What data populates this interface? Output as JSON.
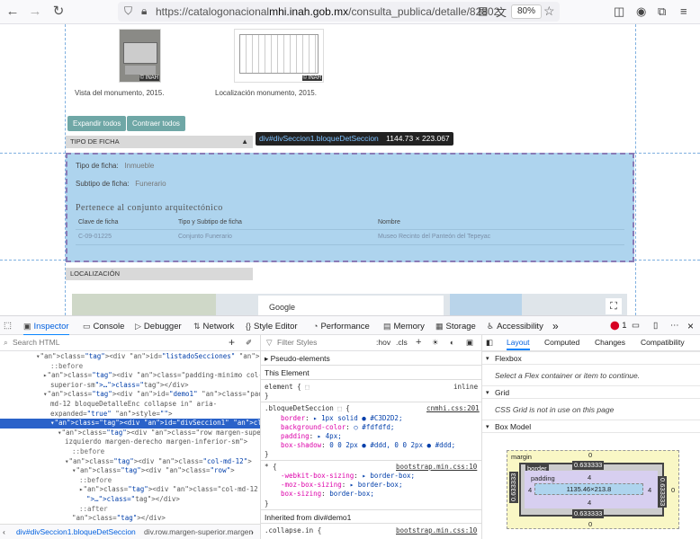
{
  "browser": {
    "url_prefix": "https://catalogonacional",
    "url_domain": "mhi.inah.gob.mx",
    "url_path": "/consulta_publica/detalle/82802",
    "zoom": "80%"
  },
  "page": {
    "thumb1_watermark": "© INAH",
    "thumb2_watermark": "© INAH",
    "caption1": "Vista del monumento, 2015.",
    "caption2": "Localización monumento, 2015.",
    "expand_all": "Expandir todos",
    "collapse_all": "Contraer todos",
    "section1_title": "TIPO DE FICHA",
    "section2_title": "LOCALIZACIÓN",
    "tooltip_selector": "div#divSeccion1.bloqueDetSeccion",
    "tooltip_size": "1144.73 × 223.067",
    "tipo_label": "Tipo de ficha:",
    "tipo_value": "Inmueble",
    "subtipo_label": "Subtipo de ficha:",
    "subtipo_value": "Funerario",
    "conjunto_heading": "Pertenece al conjunto arquitectónico",
    "table_headers": [
      "Clave de ficha",
      "Tipo y Subtipo de ficha",
      "Nombre"
    ],
    "table_row": [
      "C-09-01225",
      "Conjunto Funerario",
      "Museo Recinto del Panteón del Tepeyac"
    ],
    "map_popup": "Google"
  },
  "devtools": {
    "tabs": [
      "Inspector",
      "Console",
      "Debugger",
      "Network",
      "Style Editor",
      "Performance",
      "Memory",
      "Storage",
      "Accessibility"
    ],
    "error_count": "1",
    "search_html": "Search HTML",
    "filter_styles": "Filter Styles",
    "hov": ":hov",
    "cls": ".cls",
    "html_lines": [
      {
        "indent": 40,
        "text": "▾<div id=\"listadoSecciones\" class=\"row\">"
      },
      {
        "indent": 56,
        "text": "::before"
      },
      {
        "indent": 48,
        "text": "▸<div class=\"padding-minimo col-md-4 margen-"
      },
      {
        "indent": 56,
        "text": "superior-sm\">…</div>"
      },
      {
        "indent": 48,
        "text": "▾<div id=\"demo1\" class=\"padding-minimo datos col-"
      },
      {
        "indent": 56,
        "text": "md-12 bloqueDetalleEnc collapse in\" aria-"
      },
      {
        "indent": 56,
        "text": "expanded=\"true\" style=\"\">"
      },
      {
        "indent": 56,
        "text": "▾<div id=\"divSeccion1\" class=\"bloqueDetSeccion\">"
      },
      {
        "indent": 64,
        "text": "▾<div class=\"row margen-superior margen-"
      },
      {
        "indent": 72,
        "text": "izquierdo margen-derecho margen-inferior-sm\">"
      },
      {
        "indent": 80,
        "text": "::before"
      },
      {
        "indent": 72,
        "text": "▾<div class=\"col-md-12\">"
      },
      {
        "indent": 80,
        "text": "▾<div class=\"row\">"
      },
      {
        "indent": 88,
        "text": "::before"
      },
      {
        "indent": 88,
        "text": "▸<div class=\"col-md-12 margen-inferior-xs"
      },
      {
        "indent": 96,
        "text": "\">…</div>"
      },
      {
        "indent": 88,
        "text": "::after"
      },
      {
        "indent": 80,
        "text": "</div>"
      }
    ],
    "breadcrumb_1": "div#divSeccion1.bloqueDetSeccion",
    "breadcrumb_2": "div.row.margen-superior.margen",
    "pseudo_elements": "Pseudo-elements",
    "this_element": "This Element",
    "element_rule": "element {",
    "inline": "inline",
    "close_brace": "}",
    "rule1_selector": ".bloqueDetSeccion",
    "rule1_source": "cnmhi.css:201",
    "rule1_props": [
      {
        "p": "border",
        "v": "▸ 1px solid ● #C3D2D2;"
      },
      {
        "p": "background-color",
        "v": "○ #fdfdfd;"
      },
      {
        "p": "padding",
        "v": "▸ 4px;"
      },
      {
        "p": "box-shadow",
        "v": "0 0 2px ● #ddd, 0 0 2px ● #ddd;"
      }
    ],
    "rule2_selector": "* {",
    "rule2_source": "bootstrap.min.css:10",
    "rule2_props": [
      {
        "p": "-webkit-box-sizing",
        "v": "▸ border-box;"
      },
      {
        "p": "-moz-box-sizing",
        "v": "▸ border-box;"
      },
      {
        "p": "box-sizing",
        "v": "border-box;"
      }
    ],
    "inherited": "Inherited from div#demo1",
    "rule3_selector": ".collapse.in {",
    "rule3_source": "bootstrap.min.css:10",
    "layout_tabs": [
      "Layout",
      "Computed",
      "Changes",
      "Compatibility"
    ],
    "flexbox": "Flexbox",
    "flexbox_note": "Select a Flex container or item to continue.",
    "grid": "Grid",
    "grid_note": "CSS Grid is not in use on this page",
    "box_model": "Box Model",
    "bm_margin_label": "margin",
    "bm_border_label": "border",
    "bm_padding_label": "padding",
    "bm_margin_top": "0",
    "bm_margin_bottom": "0",
    "bm_margin_left": "0",
    "bm_margin_right": "0",
    "bm_border_top": "0.633333",
    "bm_border_bottom": "0.633333",
    "bm_border_left": "0.633333",
    "bm_border_right": "0.633333",
    "bm_padding_top": "4",
    "bm_padding_bottom": "4",
    "bm_padding_left": "4",
    "bm_padding_right": "4",
    "bm_content": "1135.46×213.8"
  }
}
